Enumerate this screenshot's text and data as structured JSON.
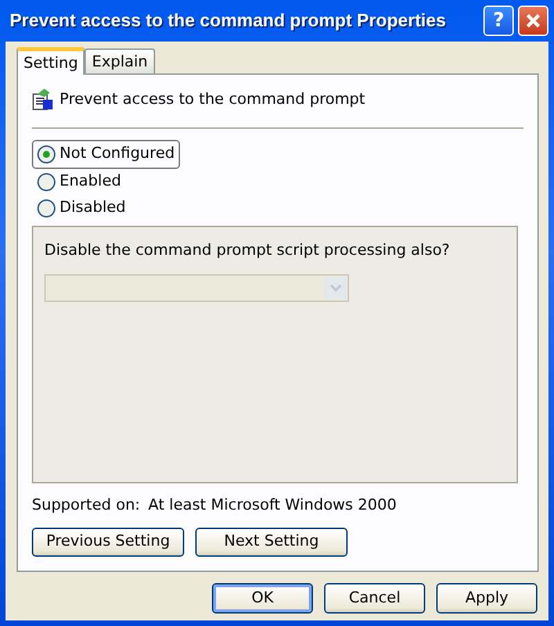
{
  "window": {
    "title": "Prevent access to the command prompt Properties",
    "help": "?"
  },
  "tabs": [
    {
      "label": "Setting",
      "selected": true
    },
    {
      "label": "Explain",
      "selected": false
    }
  ],
  "policy": {
    "title": "Prevent access to the command prompt"
  },
  "options": [
    {
      "label": "Not Configured",
      "selected": true
    },
    {
      "label": "Enabled",
      "selected": false
    },
    {
      "label": "Disabled",
      "selected": false
    }
  ],
  "option_panel": {
    "label": "Disable the command prompt script processing also?",
    "dropdown": {
      "disabled": true
    }
  },
  "supported_on": {
    "label": "Supported on:",
    "value": "At least Microsoft Windows 2000"
  },
  "nav_buttons": [
    "Previous Setting",
    "Next Setting"
  ],
  "buttons": [
    {
      "label": "OK",
      "default": true
    },
    {
      "label": "Cancel",
      "default": false
    },
    {
      "label": "Apply",
      "default": false
    }
  ]
}
